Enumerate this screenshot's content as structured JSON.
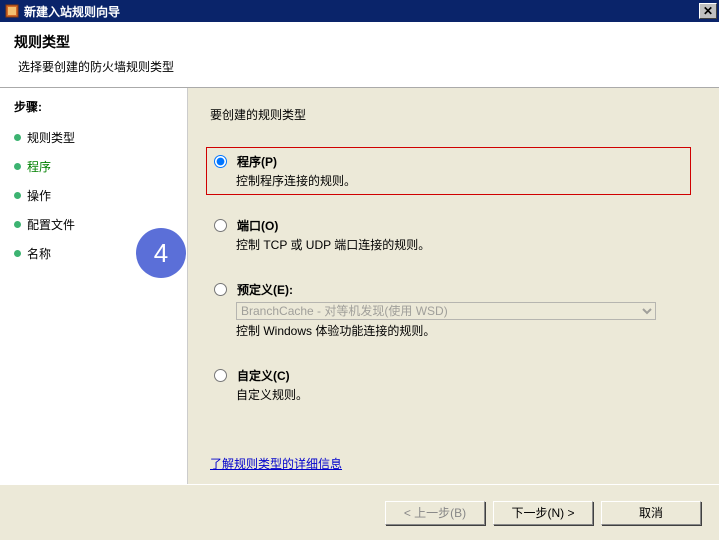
{
  "window": {
    "title": "新建入站规则向导"
  },
  "header": {
    "title": "规则类型",
    "subtitle": "选择要创建的防火墙规则类型"
  },
  "sidebar": {
    "steps_label": "步骤:",
    "items": [
      {
        "label": "规则类型"
      },
      {
        "label": "程序"
      },
      {
        "label": "操作"
      },
      {
        "label": "配置文件"
      },
      {
        "label": "名称"
      }
    ]
  },
  "content": {
    "prompt": "要创建的规则类型",
    "options": {
      "program": {
        "label": "程序(P)",
        "desc": "控制程序连接的规则。"
      },
      "port": {
        "label": "端口(O)",
        "desc": "控制 TCP 或 UDP 端口连接的规则。"
      },
      "predefined": {
        "label": "预定义(E):",
        "select_value": "BranchCache - 对等机发现(使用 WSD)",
        "desc": "控制 Windows 体验功能连接的规则。"
      },
      "custom": {
        "label": "自定义(C)",
        "desc": "自定义规则。"
      }
    },
    "link": "了解规则类型的详细信息"
  },
  "footer": {
    "back": "< 上一步(B)",
    "next": "下一步(N) >",
    "cancel": "取消"
  },
  "marker": {
    "number": "4"
  }
}
